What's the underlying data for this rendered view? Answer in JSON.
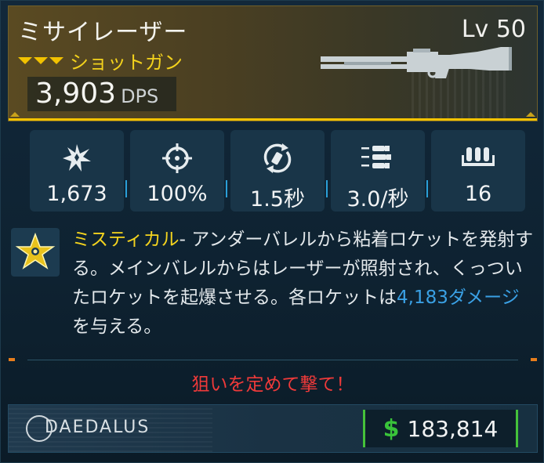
{
  "weapon": {
    "name": "ミサイレーザー",
    "type": "ショットガン",
    "level": "Lv 50",
    "dps_value": "3,903",
    "dps_unit": "DPS",
    "rarity_color": "#f2c200",
    "art_icon": "shotgun-silhouette"
  },
  "stats": [
    {
      "icon": "burst-damage-icon",
      "value": "1,673"
    },
    {
      "icon": "crosshair-accuracy-icon",
      "value": "100%"
    },
    {
      "icon": "reload-icon",
      "value": "1.5秒"
    },
    {
      "icon": "bullets-fire-rate-icon",
      "value": "3.0/秒"
    },
    {
      "icon": "magazine-icon",
      "value": "16"
    }
  ],
  "description": {
    "icon": "mystic-star-icon",
    "rarity_label": "ミスティカル",
    "text_before": "- アンダーバレルから粘着ロケットを発射する。メインバレルからはレーザーが照射され、くっついたロケットを起爆させる。各ロケットは",
    "damage_text": "4,183ダメージ",
    "text_after": "を与える。"
  },
  "flavor_text": "狙いを定めて撃て！",
  "footer": {
    "manufacturer": "DAEDALUS",
    "currency_symbol": "$",
    "price": "183,814"
  }
}
